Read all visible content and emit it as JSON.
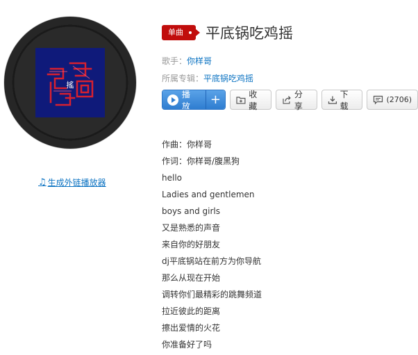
{
  "badge": "单曲",
  "song_title": "平底锅吃鸡摇",
  "singer": {
    "label": "歌手：",
    "value": "你样哥"
  },
  "album": {
    "label": "所属专辑：",
    "value": "平底锅吃鸡摇"
  },
  "cover_text": "搖",
  "buttons": {
    "play": "播放",
    "plus": "+",
    "collect": "收藏",
    "share": "分享",
    "download": "下载",
    "comment_count": "(2706)"
  },
  "generate_link": "生成外链播放器",
  "lyrics": [
    "作曲：你样哥",
    "作词：你样哥/腹黑狗",
    "hello",
    "Ladies and gentlemen",
    "boys and girls",
    "又是熟悉的声音",
    "来自你的好朋友",
    "dj平底锅站在前方为你导航",
    "那么从现在开始",
    "调转你们最精彩的跳舞频道",
    "拉近彼此的距离",
    "擦出爱情的火花",
    "你准备好了吗"
  ],
  "colors": {
    "accent_blue": "#0c73c2",
    "badge_red": "#c10d0c",
    "cover_bg": "#0f1a7a",
    "cover_art": "#d8202f"
  }
}
